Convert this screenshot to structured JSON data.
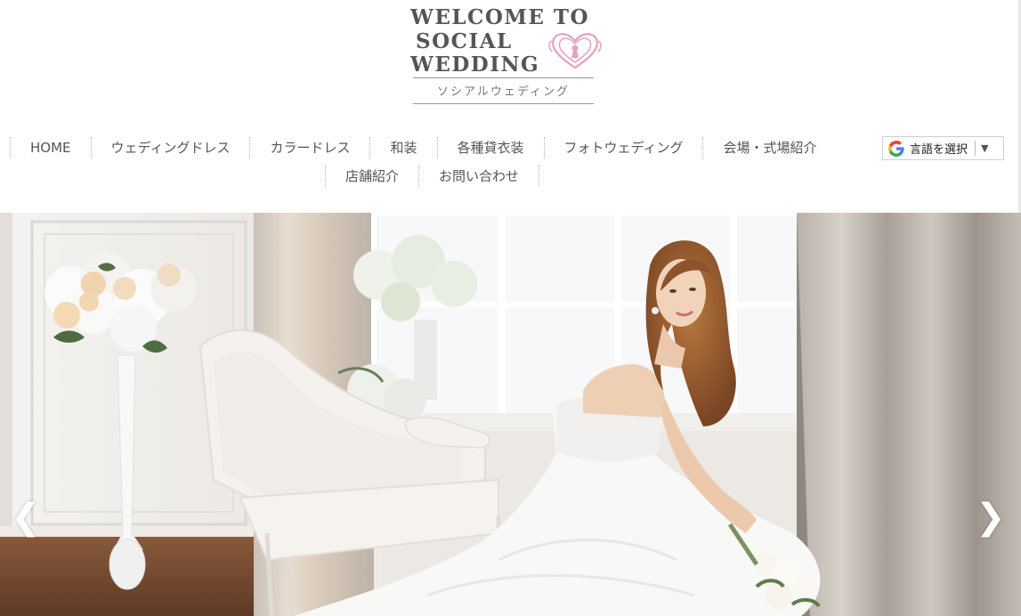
{
  "logo": {
    "line1": "WELCOME TO",
    "line2": "SOCIAL",
    "line3": "WEDDING",
    "subtitle": "ソシアルウェディング",
    "accent_color": "#e8a0c0"
  },
  "nav": {
    "row1": [
      "HOME",
      "ウェディングドレス",
      "カラードレス",
      "和装",
      "各種貸衣装",
      "フォトウェディング",
      "会場・式場紹介"
    ],
    "row2": [
      "店舗紹介",
      "お問い合わせ"
    ]
  },
  "translate": {
    "label": "言語を選択",
    "icon": "google-g-icon",
    "arrow": "▼"
  },
  "slider": {
    "prev": "❮",
    "next": "❯",
    "image": "bride-in-white-gown-seated-on-chaise"
  }
}
